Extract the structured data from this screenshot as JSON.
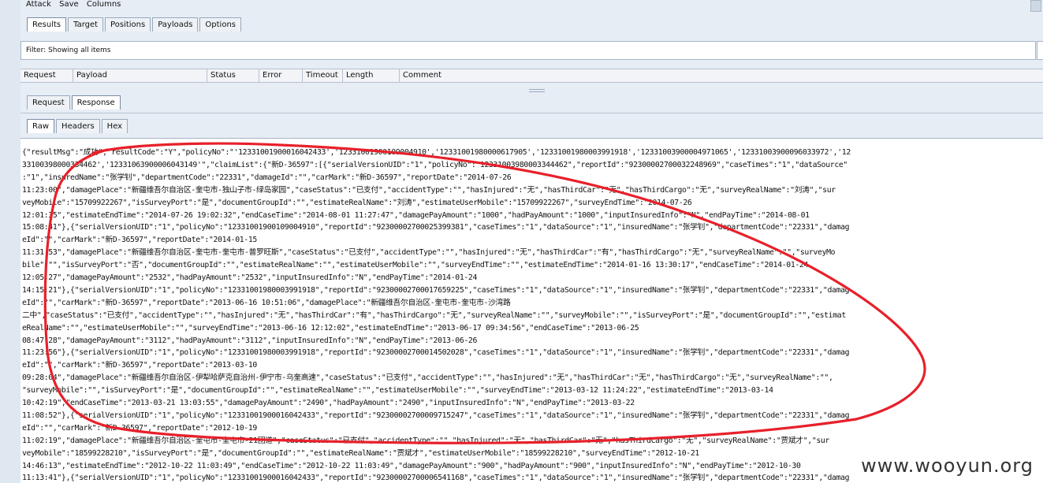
{
  "menu": [
    "Attack",
    "Save",
    "Columns"
  ],
  "top_tabs": [
    "Results",
    "Target",
    "Positions",
    "Payloads",
    "Options"
  ],
  "filter": "Filter: Showing all items",
  "columns": [
    "Request",
    "Payload",
    "Status",
    "Error",
    "Timeout",
    "Length",
    "Comment"
  ],
  "rr_tabs": [
    "Request",
    "Response"
  ],
  "format_tabs": [
    "Raw",
    "Headers",
    "Hex"
  ],
  "response_lines": [
    "{\"resultMsg\":\"成功\",\"resultCode\":\"Y\",\"policyNo\":\"'12331001900016042433','12331001900109004910','12331001980000617905','12331001980003991918','12331003900004971065','12331003900096033972','12",
    "33100398000334462','12331063900006043149'\",\"claimList\":{\"新D-36597\":[{\"serialVersionUID\":\"1\",\"policyNo\":\"12331003980003344462\",\"reportId\":\"92300002700032248969\",\"caseTimes\":\"1\",\"dataSource\"",
    ":\"1\",\"insuredName\":\"张学钊\",\"departmentCode\":\"22331\",\"damageId\":\"\",\"carMark\":\"新D-36597\",\"reportDate\":\"2014-07-26",
    "11:23:00\",\"damagePlace\":\"新疆维吾尔自治区-奎屯市-独山子市-绿岛家园\",\"caseStatus\":\"已支付\",\"accidentType\":\"\",\"hasInjured\":\"无\",\"hasThirdCar\":\"无\",\"hasThirdCargo\":\"无\",\"surveyRealName\":\"刘涛\",\"sur",
    "veyMobile\":\"15709922267\",\"isSurveyPort\":\"是\",\"documentGroupId\":\"\",\"estimateRealName\":\"刘涛\",\"estimateUserMobile\":\"15709922267\",\"surveyEndTime\":\"2014-07-26",
    "12:01:35\",\"estimateEndTime\":\"2014-07-26 19:02:32\",\"endCaseTime\":\"2014-08-01 11:27:47\",\"damagePayAmount\":\"1000\",\"hadPayAmount\":\"1000\",\"inputInsuredInfo\":\"N\",\"endPayTime\":\"2014-08-01",
    "15:08:41\"},{\"serialVersionUID\":\"1\",\"policyNo\":\"12331001900109004910\",\"reportId\":\"92300002700025399381\",\"caseTimes\":\"1\",\"dataSource\":\"1\",\"insuredName\":\"张学钊\",\"departmentCode\":\"22331\",\"damag",
    "eId\":\"\",\"carMark\":\"新D-36597\",\"reportDate\":\"2014-01-15",
    "11:31:53\",\"damagePlace\":\"新疆维吾尔自治区-奎屯市-奎屯市-普罗旺斯\",\"caseStatus\":\"已支付\",\"accidentType\":\"\",\"hasInjured\":\"无\",\"hasThirdCar\":\"有\",\"hasThirdCargo\":\"无\",\"surveyRealName\":\"\",\"surveyMo",
    "bile\":\"\",\"isSurveyPort\":\"否\",\"documentGroupId\":\"\",\"estimateRealName\":\"\",\"estimateUserMobile\":\"\",\"surveyEndTime\":\"\",\"estimateEndTime\":\"2014-01-16 13:30:17\",\"endCaseTime\":\"2014-01-24",
    "12:05:27\",\"damagePayAmount\":\"2532\",\"hadPayAmount\":\"2532\",\"inputInsuredInfo\":\"N\",\"endPayTime\":\"2014-01-24",
    "14:15:21\"},{\"serialVersionUID\":\"1\",\"policyNo\":\"12331001980003991918\",\"reportId\":\"92300002700017659225\",\"caseTimes\":\"1\",\"dataSource\":\"1\",\"insuredName\":\"张学钊\",\"departmentCode\":\"22331\",\"damag",
    "eId\":\"\",\"carMark\":\"新D-36597\",\"reportDate\":\"2013-06-16 10:51:06\",\"damagePlace\":\"新疆维吾尔自治区-奎屯市-奎屯市-沙湾路",
    "二中\",\"caseStatus\":\"已支付\",\"accidentType\":\"\",\"hasInjured\":\"无\",\"hasThirdCar\":\"有\",\"hasThirdCargo\":\"无\",\"surveyRealName\":\"\",\"surveyMobile\":\"\",\"isSurveyPort\":\"是\",\"documentGroupId\":\"\",\"estimat",
    "eRealName\":\"\",\"estimateUserMobile\":\"\",\"surveyEndTime\":\"2013-06-16 12:12:02\",\"estimateEndTime\":\"2013-06-17 09:34:56\",\"endCaseTime\":\"2013-06-25",
    "08:47:28\",\"damagePayAmount\":\"3112\",\"hadPayAmount\":\"3112\",\"inputInsuredInfo\":\"N\",\"endPayTime\":\"2013-06-26",
    "11:23:56\"},{\"serialVersionUID\":\"1\",\"policyNo\":\"12331001980003991918\",\"reportId\":\"92300002700014502028\",\"caseTimes\":\"1\",\"dataSource\":\"1\",\"insuredName\":\"张学钊\",\"departmentCode\":\"22331\",\"damag",
    "eId\":\"\",\"carMark\":\"新D-36597\",\"reportDate\":\"2013-03-10",
    "09:28:04\",\"damagePlace\":\"新疆维吾尔自治区-伊犁哈萨克自治州-伊宁市-乌奎高速\",\"caseStatus\":\"已支付\",\"accidentType\":\"\",\"hasInjured\":\"无\",\"hasThirdCar\":\"无\",\"hasThirdCargo\":\"无\",\"surveyRealName\":\"\",",
    "\"surveyMobile\":\"\",\"isSurveyPort\":\"是\",\"documentGroupId\":\"\",\"estimateRealName\":\"\",\"estimateUserMobile\":\"\",\"surveyEndTime\":\"2013-03-12 11:24:22\",\"estimateEndTime\":\"2013-03-14",
    "10:42:19\",\"endCaseTime\":\"2013-03-21 13:03:55\",\"damagePayAmount\":\"2490\",\"hadPayAmount\":\"2490\",\"inputInsuredInfo\":\"N\",\"endPayTime\":\"2013-03-22",
    "11:08:52\"},{\"serialVersionUID\":\"1\",\"policyNo\":\"12331001900016042433\",\"reportId\":\"92300002700009715247\",\"caseTimes\":\"1\",\"dataSource\":\"1\",\"insuredName\":\"张学钊\",\"departmentCode\":\"22331\",\"damag",
    "eId\":\"\",\"carMark\":\"新D-36597\",\"reportDate\":\"2012-10-19",
    "11:02:19\",\"damagePlace\":\"新疆维吾尔自治区-奎屯市-奎屯市-21团道\",\"caseStatus\":\"已支付\",\"accidentType\":\"\",\"hasInjured\":\"无\",\"hasThirdCar\":\"无\",\"hasThirdCargo\":\"无\",\"surveyRealName\":\"贾斌才\",\"sur",
    "veyMobile\":\"18599228210\",\"isSurveyPort\":\"是\",\"documentGroupId\":\"\",\"estimateRealName\":\"贾斌才\",\"estimateUserMobile\":\"18599228210\",\"surveyEndTime\":\"2012-10-21",
    "14:46:13\",\"estimateEndTime\":\"2012-10-22 11:03:49\",\"endCaseTime\":\"2012-10-22 11:03:49\",\"damagePayAmount\":\"900\",\"hadPayAmount\":\"900\",\"inputInsuredInfo\":\"N\",\"endPayTime\":\"2012-10-30",
    "11:13:41\"},{\"serialVersionUID\":\"1\",\"policyNo\":\"12331001900016042433\",\"reportId\":\"92300002700006541168\",\"caseTimes\":\"1\",\"dataSource\":\"1\",\"insuredName\":\"张学钊\",\"departmentCode\":\"22331\",\"damag"
  ],
  "watermark": "www.wooyun.org",
  "colors": {
    "annotation": "#e8202a",
    "background": "#e6edf5"
  }
}
